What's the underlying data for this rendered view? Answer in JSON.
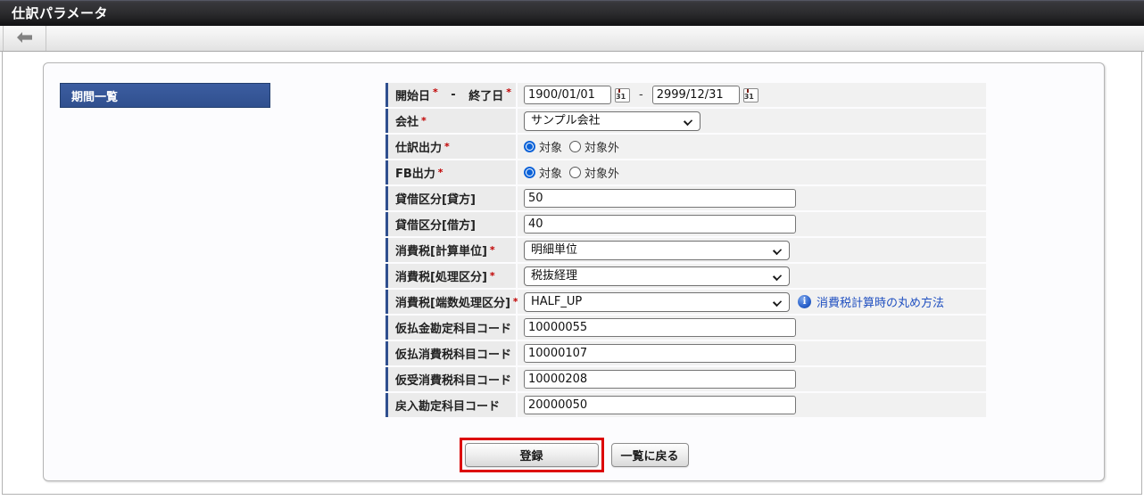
{
  "window": {
    "title": "仕訳パラメータ"
  },
  "section": {
    "title": "期間一覧"
  },
  "form": {
    "calendar_glyph": "31",
    "rows": [
      {
        "label_start": "開始日",
        "label_end": "終了日",
        "separator": "-",
        "required": "*",
        "start_value": "1900/01/01",
        "end_value": "2999/12/31"
      },
      {
        "label": "会社",
        "required": "*",
        "value": "サンプル会社"
      },
      {
        "label": "仕訳出力",
        "required": "*",
        "option_on": "対象",
        "option_off": "対象外",
        "selected": "対象"
      },
      {
        "label": "FB出力",
        "required": "*",
        "option_on": "対象",
        "option_off": "対象外",
        "selected": "対象"
      },
      {
        "label": "貸借区分[貸方]",
        "value": "50"
      },
      {
        "label": "貸借区分[借方]",
        "value": "40"
      },
      {
        "label": "消費税[計算単位]",
        "required": "*",
        "value": "明細単位"
      },
      {
        "label": "消費税[処理区分]",
        "required": "*",
        "value": "税抜経理"
      },
      {
        "label": "消費税[端数処理区分]",
        "required": "*",
        "value": "HALF_UP",
        "info_link": "消費税計算時の丸め方法"
      },
      {
        "label": "仮払金勘定科目コード",
        "value": "10000055"
      },
      {
        "label": "仮払消費税科目コード",
        "value": "10000107"
      },
      {
        "label": "仮受消費税科目コード",
        "value": "10000208"
      },
      {
        "label": "戻入勘定科目コード",
        "value": "20000050"
      }
    ]
  },
  "actions": {
    "submit_label": "登録",
    "back_label": "一覧に戻る"
  },
  "colors": {
    "accent_blue": "#2F4F8F",
    "section_header_bg": "#33549A",
    "annotation_red": "#DC0000",
    "link_blue": "#1F4FC0",
    "radio_blue": "#0B62D8"
  }
}
